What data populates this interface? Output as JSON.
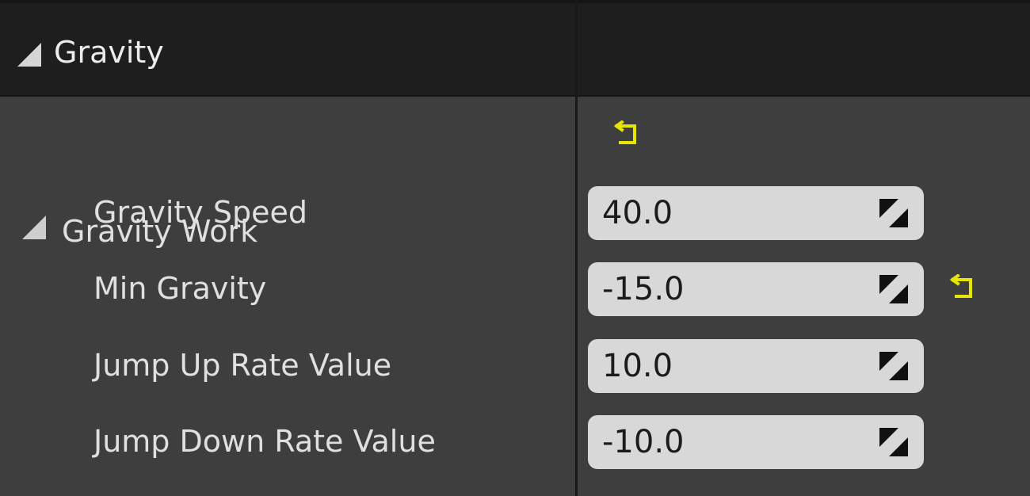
{
  "category": {
    "label": "Gravity"
  },
  "group": {
    "label": "Gravity Work"
  },
  "properties": [
    {
      "label": "Gravity Speed",
      "value": "40.0"
    },
    {
      "label": "Min Gravity",
      "value": "-15.0"
    },
    {
      "label": "Jump Up Rate Value",
      "value": "10.0"
    },
    {
      "label": "Jump Down Rate Value",
      "value": "-10.0"
    }
  ],
  "icons": {
    "collapse": "triangle-down-right-icon",
    "reset": "reset-to-default-icon",
    "drag": "drag-handle-icon"
  },
  "colors": {
    "reset_icon": "#e6e600",
    "header_bg": "#1e1e1e",
    "panel_bg": "#3e3e3e",
    "field_bg": "#d8d8d8"
  }
}
